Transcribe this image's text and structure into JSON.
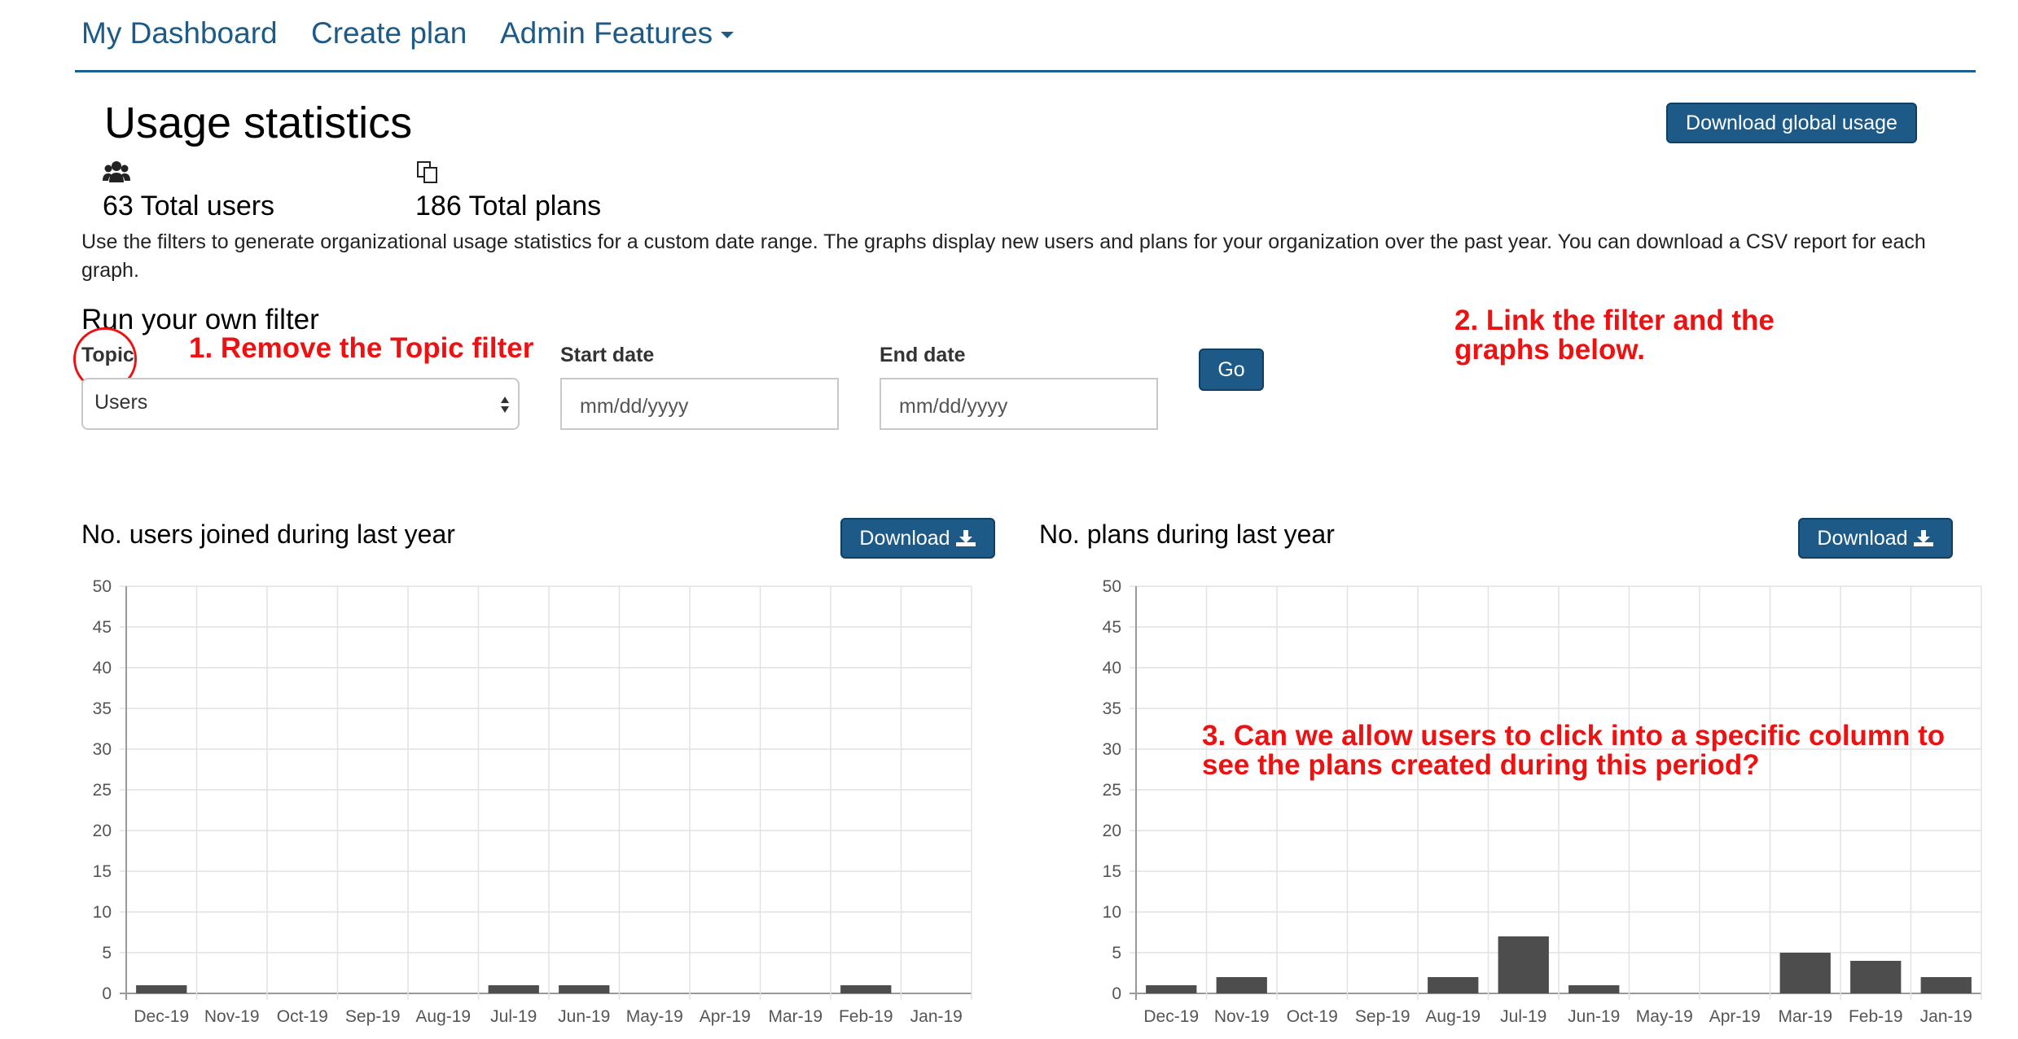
{
  "nav": {
    "items": [
      "My Dashboard",
      "Create plan",
      "Admin Features"
    ]
  },
  "page": {
    "title": "Usage statistics",
    "download_global_label": "Download global usage",
    "stats": {
      "users_icon": "users-icon",
      "users": "63 Total users",
      "plans_icon": "copy-icon",
      "plans": "186 Total plans"
    },
    "description": "Use the filters to generate organizational usage statistics for a custom date range. The graphs display new users and plans for your organization over the past year. You can download a CSV report for each graph."
  },
  "filter": {
    "title": "Run your own filter",
    "topic_label": "Topic",
    "topic_value": "Users",
    "start_label": "Start date",
    "start_placeholder": "mm/dd/yyyy",
    "end_label": "End date",
    "end_placeholder": "mm/dd/yyyy",
    "go_label": "Go"
  },
  "annotations": {
    "a1": "1. Remove the Topic filter",
    "a2_line1": "2. Link the filter and the",
    "a2_line2": "graphs below.",
    "a3_line1": "3. Can we allow users to click into a specific column to",
    "a3_line2": "see the plans created during this period?",
    "color": "#ee1111"
  },
  "charts": {
    "users_title": "No. users joined during last year",
    "plans_title": "No. plans during last year",
    "download_label": "Download",
    "download_icon": "download-icon"
  },
  "colors": {
    "accent": "#1d5a87",
    "bar": "#4d4d4d",
    "annotation": "#ee1111"
  },
  "chart_data": [
    {
      "type": "bar",
      "title": "No. users joined during last year",
      "categories": [
        "Dec-19",
        "Nov-19",
        "Oct-19",
        "Sep-19",
        "Aug-19",
        "Jul-19",
        "Jun-19",
        "May-19",
        "Apr-19",
        "Mar-19",
        "Feb-19",
        "Jan-19"
      ],
      "values": [
        1,
        0,
        0,
        0,
        0,
        1,
        1,
        0,
        0,
        0,
        1,
        0
      ],
      "ylim": [
        0,
        50
      ],
      "yticks": [
        0,
        5,
        10,
        15,
        20,
        25,
        30,
        35,
        40,
        45,
        50
      ],
      "grid": true
    },
    {
      "type": "bar",
      "title": "No. plans during last year",
      "categories": [
        "Dec-19",
        "Nov-19",
        "Oct-19",
        "Sep-19",
        "Aug-19",
        "Jul-19",
        "Jun-19",
        "May-19",
        "Apr-19",
        "Mar-19",
        "Feb-19",
        "Jan-19"
      ],
      "values": [
        1,
        2,
        0,
        0,
        2,
        7,
        1,
        0,
        0,
        5,
        4,
        2
      ],
      "ylim": [
        0,
        50
      ],
      "yticks": [
        0,
        5,
        10,
        15,
        20,
        25,
        30,
        35,
        40,
        45,
        50
      ],
      "grid": true
    }
  ]
}
